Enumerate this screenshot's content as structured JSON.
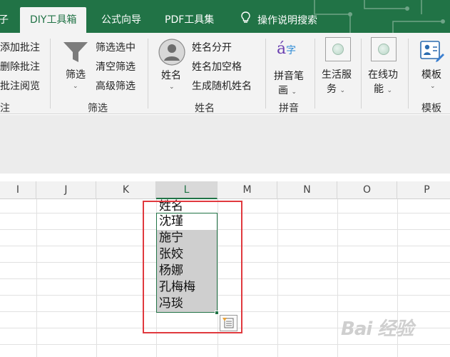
{
  "tabs": [
    {
      "label": "子"
    },
    {
      "label": "DIY工具箱",
      "active": true
    },
    {
      "label": "公式向导"
    },
    {
      "label": "PDF工具集"
    },
    {
      "label": "操作说明搜索"
    }
  ],
  "ribbon": {
    "annotation": {
      "items": [
        "添加批注",
        "删除批注",
        "批注阅览"
      ],
      "group_label": "注"
    },
    "filter": {
      "big_button": "筛选",
      "items": [
        "筛选选中",
        "清空筛选",
        "高级筛选"
      ],
      "group_label": "筛选"
    },
    "name": {
      "big_button": "姓名",
      "items": [
        "姓名分开",
        "姓名加空格",
        "生成随机姓名"
      ],
      "group_label": "姓名"
    },
    "pinyin": {
      "big_button_line1": "拼音笔",
      "big_button_line2": "画",
      "group_label": "拼音"
    },
    "life": {
      "line1": "生活服",
      "line2": "务"
    },
    "online": {
      "line1": "在线功",
      "line2": "能"
    },
    "template": {
      "big_button": "模板",
      "group_label": "模板"
    }
  },
  "columns": [
    "I",
    "J",
    "K",
    "L",
    "M",
    "N",
    "O",
    "P"
  ],
  "cells": {
    "header": "姓名",
    "names": [
      "沈瑾",
      "施宁",
      "张姣",
      "杨娜",
      "孔梅梅",
      "冯琰"
    ]
  },
  "watermark": "Bai 经验",
  "colors": {
    "accent": "#217346",
    "highlight": "#e0393e",
    "selection_fill": "#cfcfcf"
  }
}
